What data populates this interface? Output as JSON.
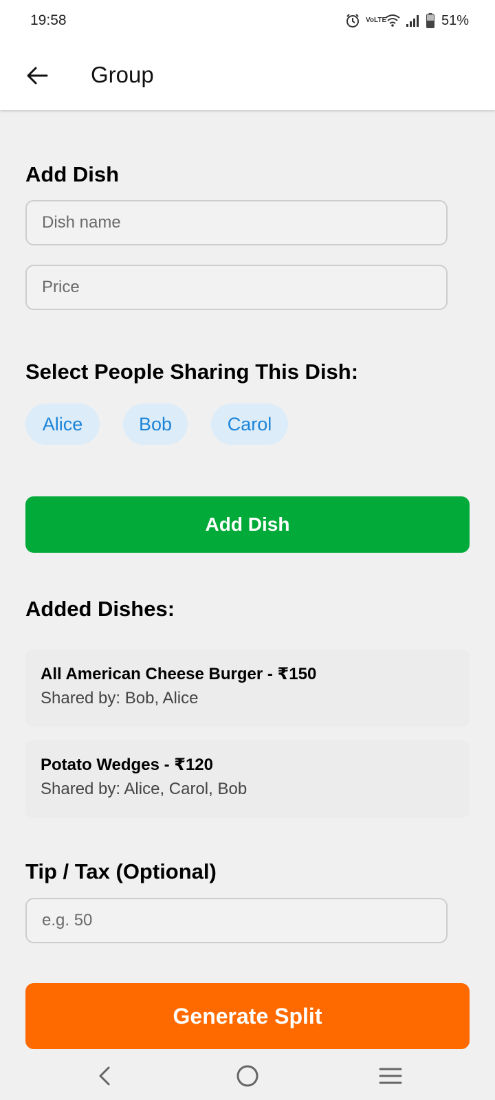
{
  "status_bar": {
    "time": "19:58",
    "battery": "51%",
    "network_label": "VoLTE"
  },
  "app_bar": {
    "title": "Group"
  },
  "add_dish": {
    "heading": "Add Dish",
    "dish_name_placeholder": "Dish name",
    "price_placeholder": "Price",
    "people_heading": "Select People Sharing This Dish:",
    "people": [
      "Alice",
      "Bob",
      "Carol"
    ],
    "button_label": "Add Dish"
  },
  "added_dishes": {
    "heading": "Added Dishes:",
    "items": [
      {
        "title": "All American Cheese Burger - ₹150",
        "shared": "Shared by: Bob, Alice"
      },
      {
        "title": "Potato Wedges - ₹120",
        "shared": "Shared by: Alice, Carol, Bob"
      }
    ]
  },
  "tip_tax": {
    "heading": "Tip / Tax (Optional)",
    "placeholder": "e.g. 50"
  },
  "generate_button": {
    "label": "Generate Split"
  },
  "colors": {
    "add_button": "#02aa39",
    "generate_button": "#ff6a00",
    "chip_bg": "#dcecf9",
    "chip_text": "#1b84d8",
    "background": "#f0f0f0"
  },
  "icons": {
    "back": "arrow-left-icon",
    "nav_back": "chevron-left-icon",
    "nav_home": "circle-home-icon",
    "nav_menu": "hamburger-menu-icon"
  }
}
